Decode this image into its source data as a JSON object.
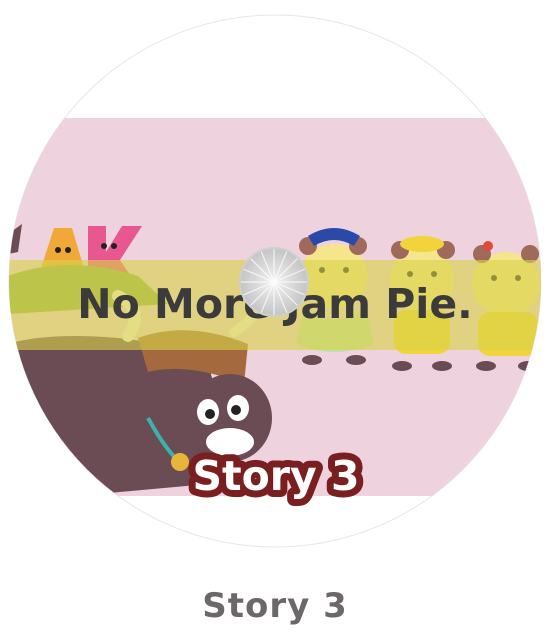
{
  "disc": {
    "banner_title": "No More Jam Pie.",
    "story_label": "Story 3",
    "logo_fragment": "y",
    "letters": [
      "A",
      "K"
    ]
  },
  "caption": {
    "label": "Story 3"
  },
  "colors": {
    "background_pink": "#f1d6e0",
    "banner_yellow": "#d9d24a",
    "label_fill": "#7a1f1f",
    "caption_gray": "#6c6769",
    "yak_brown": "#6b4b54",
    "hamster_yellow": "#f5e58c"
  }
}
